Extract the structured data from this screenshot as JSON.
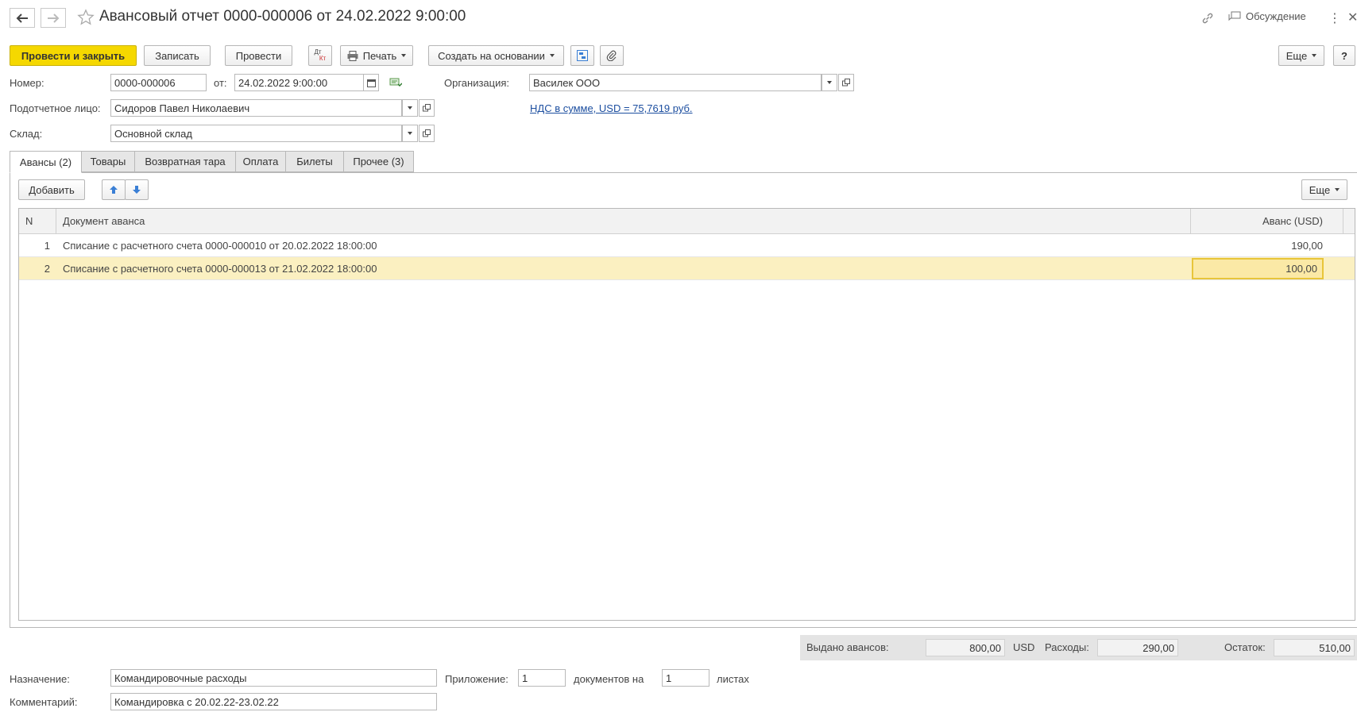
{
  "header": {
    "title": "Авансовый отчет 0000-000006 от 24.02.2022 9:00:00",
    "discussion_label": "Обсуждение"
  },
  "toolbar": {
    "post_close": "Провести и закрыть",
    "save": "Записать",
    "post": "Провести",
    "dtkt_top": "Дт",
    "dtkt_bottom": "Кт",
    "print": "Печать",
    "create_based": "Создать на основании",
    "more": "Еще",
    "help": "?"
  },
  "form": {
    "number_label": "Номер:",
    "number_value": "0000-000006",
    "date_label": "от:",
    "date_value": "24.02.2022  9:00:00",
    "org_label": "Организация:",
    "org_value": "Василек ООО",
    "person_label": "Подотчетное лицо:",
    "person_value": "Сидоров Павел Николаевич",
    "vat_link": "НДС в сумме, USD = 75,7619 руб.",
    "warehouse_label": "Склад:",
    "warehouse_value": "Основной склад"
  },
  "tabs": [
    {
      "label": "Авансы (2)",
      "active": true
    },
    {
      "label": "Товары"
    },
    {
      "label": "Возвратная тара"
    },
    {
      "label": "Оплата"
    },
    {
      "label": "Билеты"
    },
    {
      "label": "Прочее (3)"
    }
  ],
  "table_toolbar": {
    "add": "Добавить",
    "more": "Еще"
  },
  "table": {
    "columns": [
      "N",
      "Документ аванса",
      "Аванс (USD)"
    ],
    "rows": [
      {
        "n": "1",
        "doc": "Списание с расчетного счета 0000-000010 от 20.02.2022 18:00:00",
        "amount": "190,00"
      },
      {
        "n": "2",
        "doc": "Списание с расчетного счета 0000-000013 от 21.02.2022 18:00:00",
        "amount": "100,00"
      }
    ]
  },
  "totals": {
    "issued_label": "Выдано авансов:",
    "issued_value": "800,00",
    "currency": "USD",
    "expenses_label": "Расходы:",
    "expenses_value": "290,00",
    "balance_label": "Остаток:",
    "balance_value": "510,00"
  },
  "footer": {
    "purpose_label": "Назначение:",
    "purpose_value": "Командировочные расходы",
    "attachment_label": "Приложение:",
    "attachment_docs": "1",
    "docs_on_label": "документов на",
    "attachment_sheets": "1",
    "sheets_label": "листах",
    "comment_label": "Комментарий:",
    "comment_value": "Командировка с 20.02.22-23.02.22"
  },
  "colors": {
    "primary_button": "#f5d800",
    "selected_row": "#fbf0c1",
    "link": "#1d4fa0",
    "arrow_blue": "#3a7fd5"
  }
}
